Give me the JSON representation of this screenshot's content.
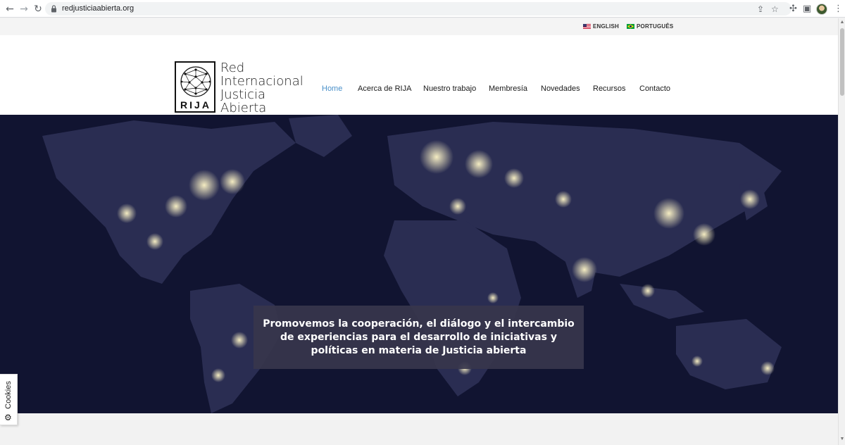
{
  "browser": {
    "url": "redjusticiaabierta.org",
    "back_icon": "arrow-left-icon",
    "forward_icon": "arrow-right-icon",
    "reload_icon": "reload-icon"
  },
  "topbar": {
    "languages": [
      {
        "label": "ENGLISH",
        "flag": "us-flag-icon"
      },
      {
        "label": "PORTUGUÊS",
        "flag": "br-flag-icon"
      }
    ]
  },
  "header": {
    "logo_abbr": "RIJA",
    "logo_lines": [
      "Red",
      "Internacional",
      "Justicia",
      "Abierta"
    ]
  },
  "nav": {
    "items": [
      {
        "label": "Home",
        "active": true
      },
      {
        "label": "Acerca de RIJA",
        "active": false
      },
      {
        "label": "Nuestro trabajo",
        "active": false
      },
      {
        "label": "Membresía",
        "active": false
      },
      {
        "label": "Novedades",
        "active": false
      },
      {
        "label": "Recursos",
        "active": false
      },
      {
        "label": "Contacto",
        "active": false
      }
    ]
  },
  "hero": {
    "caption": "Promovemos la cooperación, el diálogo y el intercambio de experiencias para el desarrollo de iniciativas y políticas en materia de Justicia abierta"
  },
  "cookies": {
    "label": "Cookies"
  },
  "colors": {
    "accent": "#4a90c9",
    "hero_bg": "#10122a",
    "caption_bg": "#37364c"
  }
}
